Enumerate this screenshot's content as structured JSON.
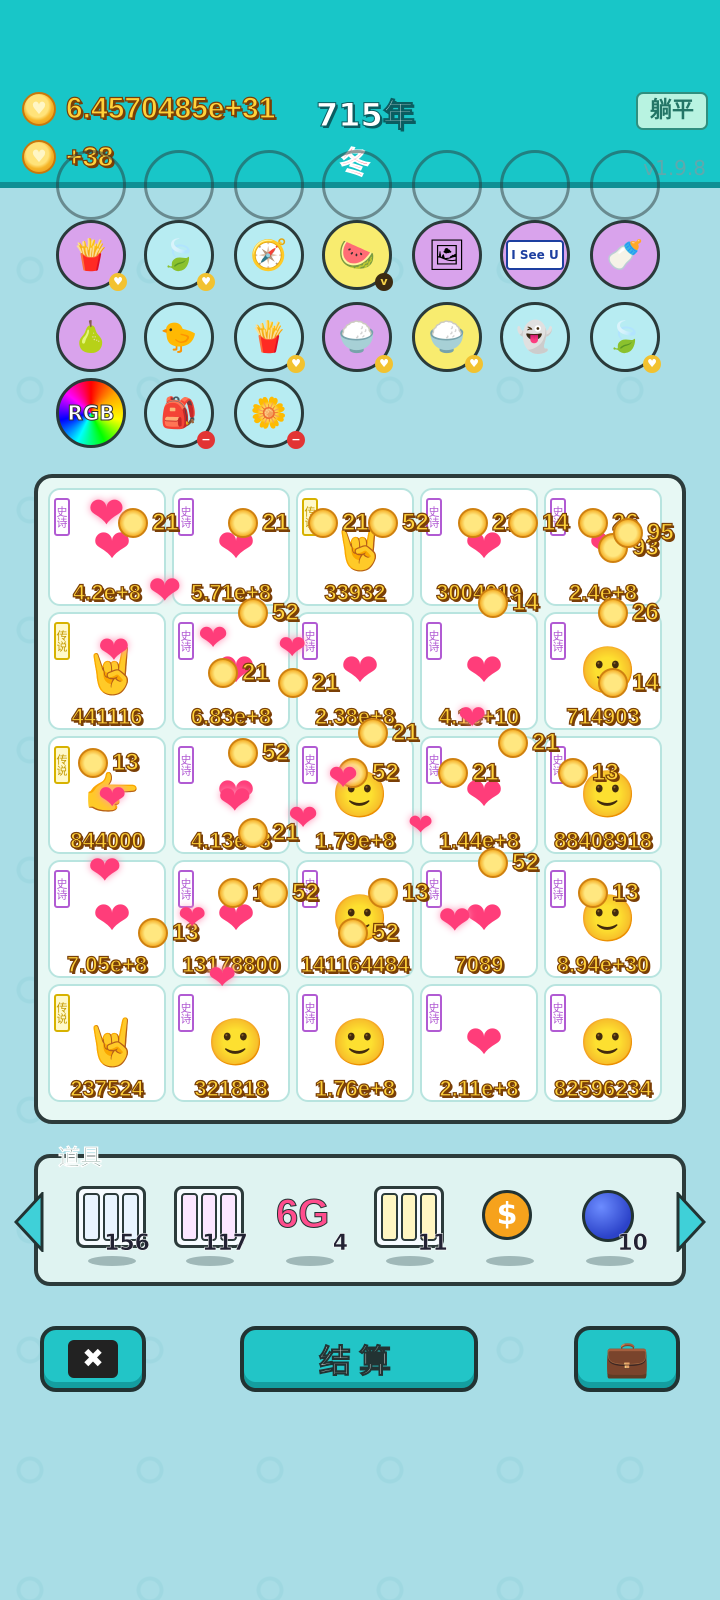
{
  "header": {
    "gold_total": "6.4570485e+31",
    "year": "715年",
    "gold_rate": "+38",
    "season": "冬",
    "flat_button": "躺平",
    "version": "v1.9.8"
  },
  "upgrades": {
    "row1": [
      "fries-icon",
      "leaf-icon",
      "compass-icon",
      "fruit-basket-icon",
      "pink-frame-icon",
      "i-see-u-icon",
      "breast-pump-icon"
    ],
    "i_see_u_label": "I See U",
    "row2": [
      "guava-icon",
      "chick-egg-icon",
      "fries-icon",
      "rice-bowl-icon",
      "rice-bowl-icon",
      "ghost-icon",
      "leaf-icon"
    ],
    "row3": [
      "rgb-icon",
      "sack-icon",
      "flower-pot-icon"
    ],
    "rgb_label": "RGB",
    "badge_v": "v"
  },
  "board": {
    "cells": [
      {
        "rank": "史诗",
        "value": "4.2e+8"
      },
      {
        "rank": "史诗",
        "value": "5.71e+8"
      },
      {
        "rank": "传说",
        "value": "33932"
      },
      {
        "rank": "史诗",
        "value": "3004019"
      },
      {
        "rank": "史诗",
        "value": "2.4e+8"
      },
      {
        "rank": "传说",
        "value": "441116"
      },
      {
        "rank": "史诗",
        "value": "6.83e+8"
      },
      {
        "rank": "史诗",
        "value": "2.38e+8"
      },
      {
        "rank": "史诗",
        "value": "4.1e+10"
      },
      {
        "rank": "史诗",
        "value": "714903"
      },
      {
        "rank": "传说",
        "value": "844000"
      },
      {
        "rank": "史诗",
        "value": "4.13e+8"
      },
      {
        "rank": "史诗",
        "value": "1.79e+8"
      },
      {
        "rank": "史诗",
        "value": "1.44e+8"
      },
      {
        "rank": "史诗",
        "value": "88408918"
      },
      {
        "rank": "史诗",
        "value": "7.05e+8"
      },
      {
        "rank": "史诗",
        "value": "13178800"
      },
      {
        "rank": "史诗",
        "value": "141164484"
      },
      {
        "rank": "史诗",
        "value": "7089"
      },
      {
        "rank": "史诗",
        "value": "8.94e+30"
      },
      {
        "rank": "传说",
        "value": "237524"
      },
      {
        "rank": "史诗",
        "value": "321818"
      },
      {
        "rank": "史诗",
        "value": "1.76e+8"
      },
      {
        "rank": "史诗",
        "value": "2.11e+8"
      },
      {
        "rank": "史诗",
        "value": "82596234"
      }
    ],
    "effects": {
      "coin_values": [
        "21",
        "21",
        "21",
        "52",
        "21",
        "14",
        "26",
        "93",
        "95",
        "52",
        "13",
        "21",
        "52",
        "21",
        "52",
        "13",
        "13",
        "13",
        "52",
        "14",
        "21",
        "13",
        "26",
        "14",
        "21",
        "52",
        "21",
        "21",
        "52",
        "13"
      ]
    }
  },
  "items": {
    "label": "道具",
    "list": [
      {
        "name": "jar-set-blue",
        "count": "156",
        "jar_label": "稀有"
      },
      {
        "name": "jar-set-pink",
        "count": "117",
        "jar_label": "史诗"
      },
      {
        "name": "6g",
        "count": "4",
        "text": "6G"
      },
      {
        "name": "jar-set-gold",
        "count": "11",
        "jar_label": "传说"
      },
      {
        "name": "dollar-coin",
        "count": "",
        "symbol": "$"
      },
      {
        "name": "blueberry",
        "count": "10"
      }
    ]
  },
  "footer": {
    "settle_button": "结算",
    "close_icon": "✖"
  },
  "colors": {
    "teal": "#18c6c8",
    "gold": "#ffd23a",
    "season_red": "#ff2d55",
    "epic": "#b15bd3",
    "legend": "#d7b200"
  }
}
